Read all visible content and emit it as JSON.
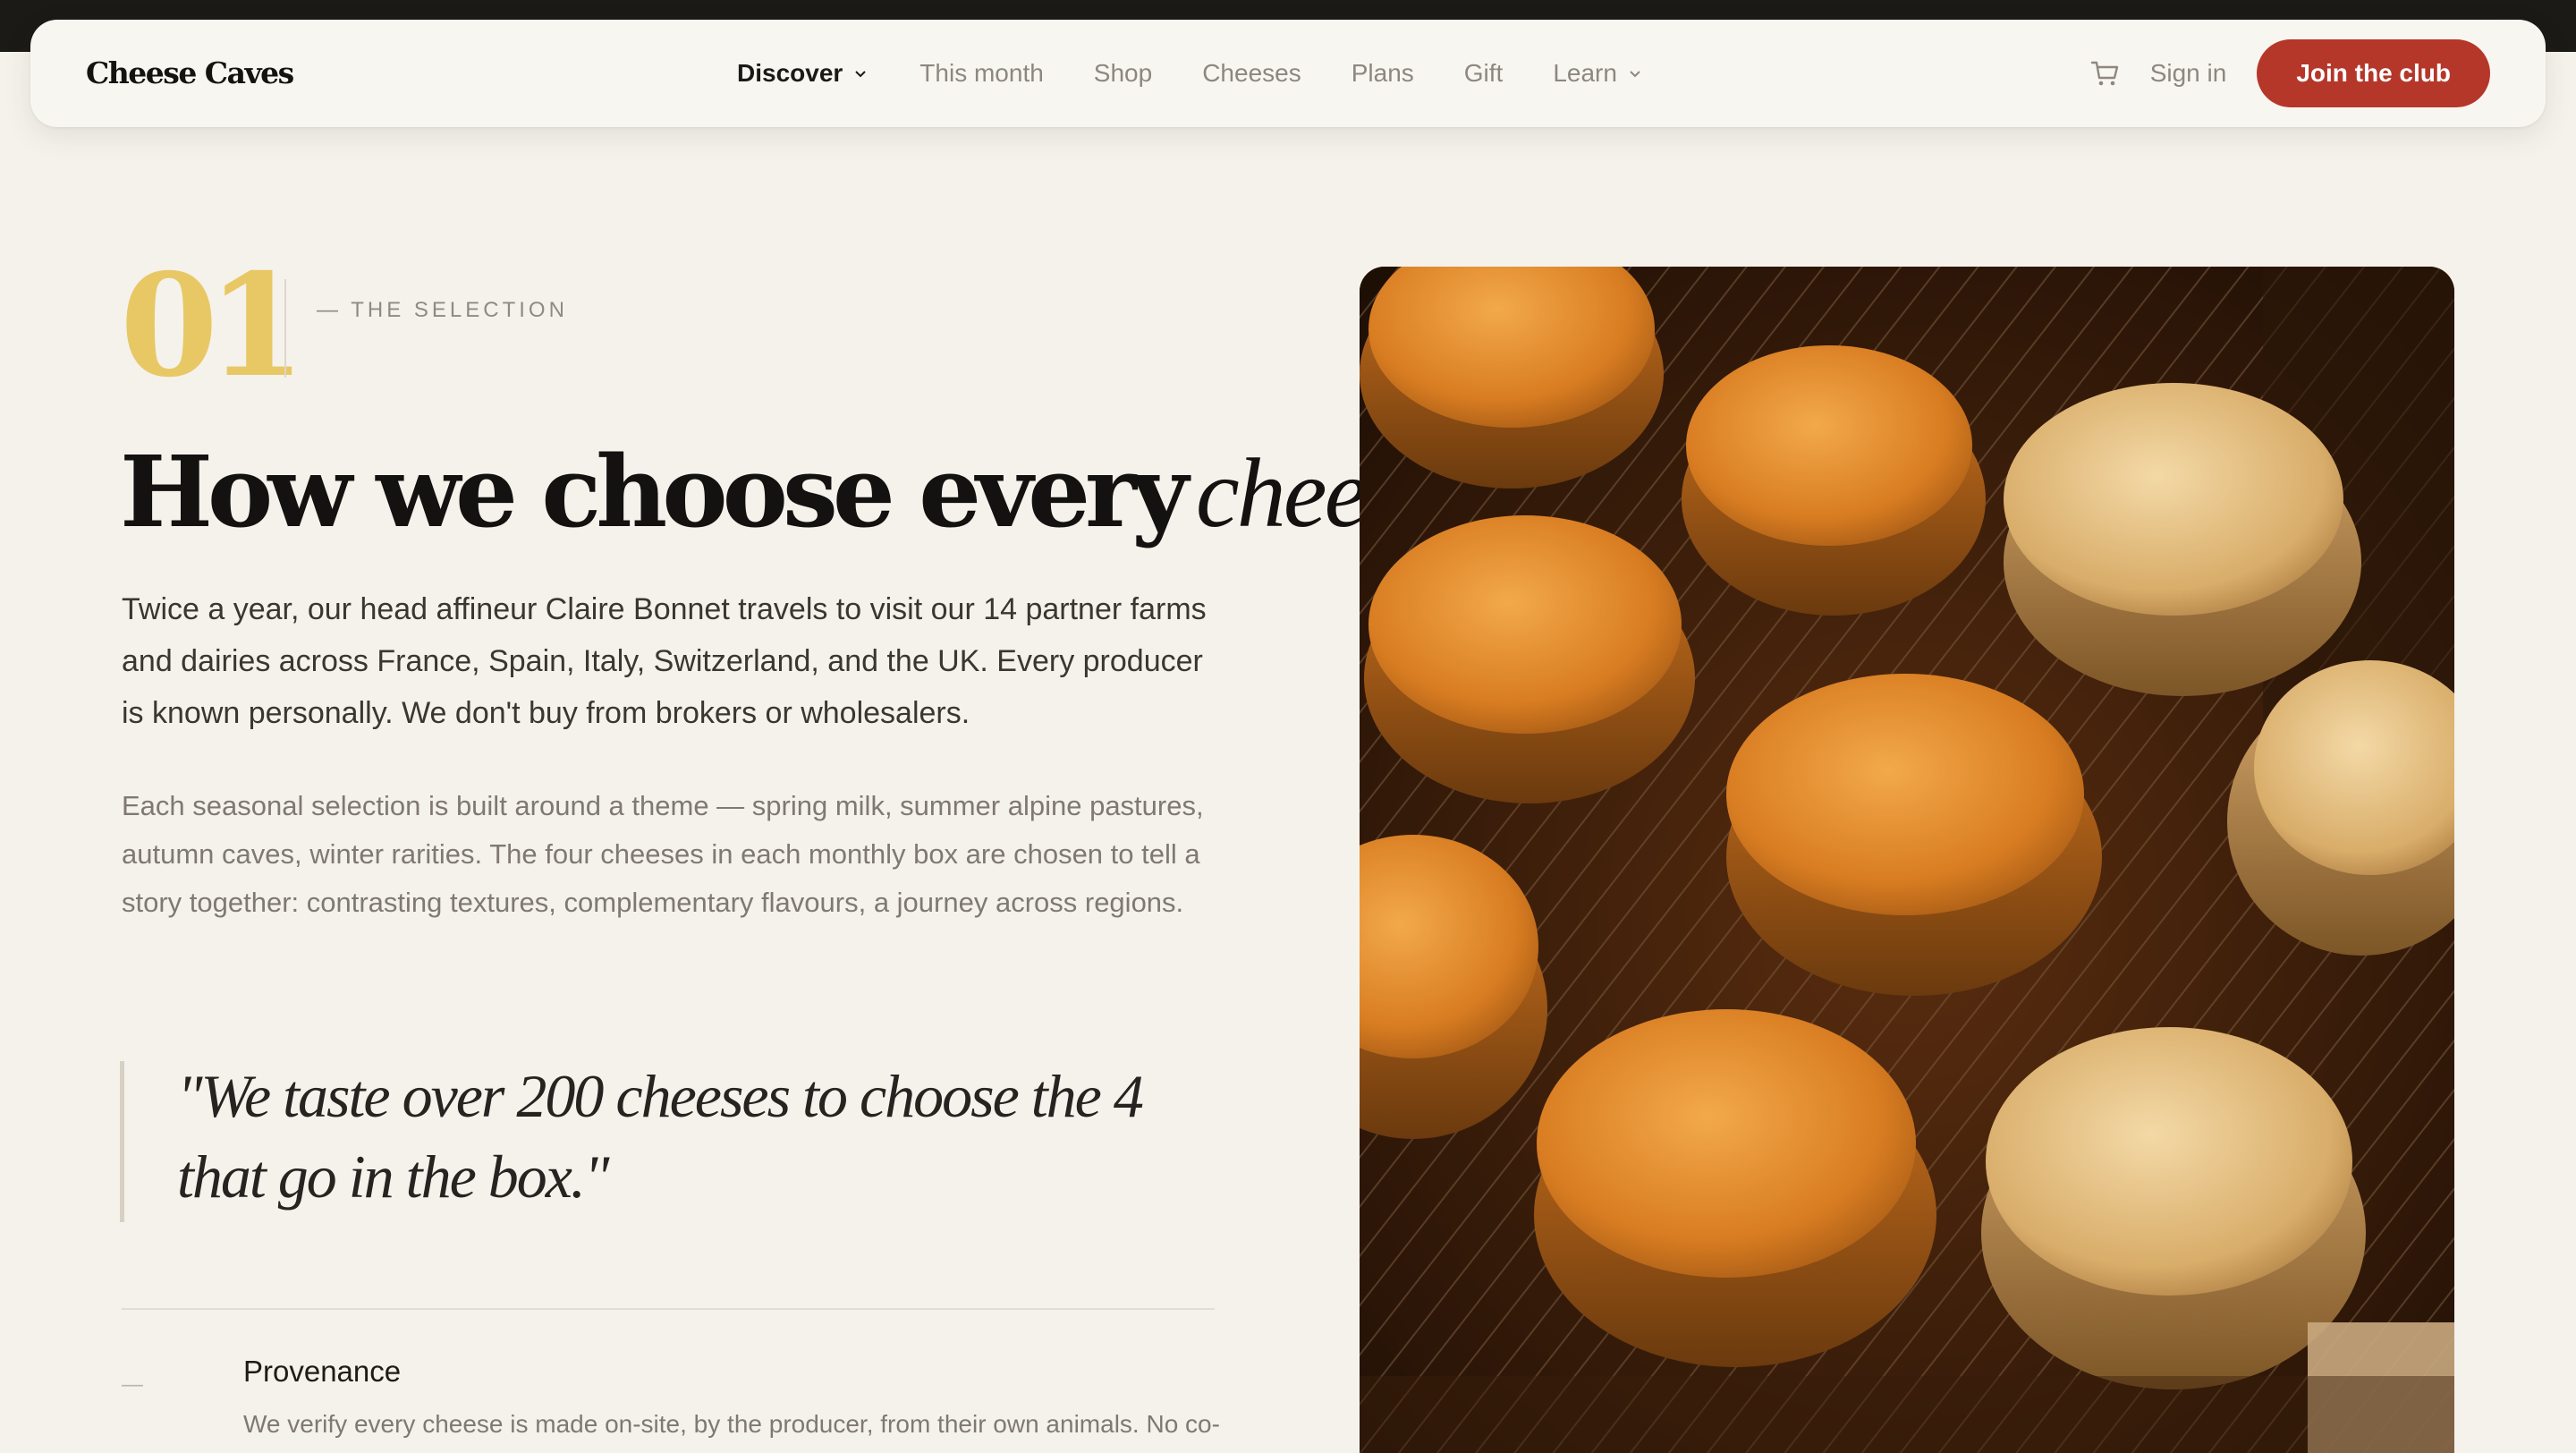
{
  "brand": {
    "name": "Cheese Caves"
  },
  "nav": {
    "items": [
      {
        "label": "Discover",
        "active": true,
        "has_dropdown": true
      },
      {
        "label": "This month",
        "active": false,
        "has_dropdown": false
      },
      {
        "label": "Shop",
        "active": false,
        "has_dropdown": false
      },
      {
        "label": "Cheeses",
        "active": false,
        "has_dropdown": false
      },
      {
        "label": "Plans",
        "active": false,
        "has_dropdown": false
      },
      {
        "label": "Gift",
        "active": false,
        "has_dropdown": false
      },
      {
        "label": "Learn",
        "active": false,
        "has_dropdown": true
      }
    ],
    "cart_icon": "cart-icon",
    "signin_label": "Sign in",
    "cta_label": "Join the club"
  },
  "section": {
    "number": "01",
    "eyebrow": "— THE SELECTION",
    "headline_bold": "How we choose every",
    "headline_italic": "cheese.",
    "lead": "Twice a year, our head affineur Claire Bonnet travels to visit our 14 partner farms and dairies across France, Spain, Italy, Switzerland, and the UK. Every producer is known personally. We don't buy from brokers or wholesalers.",
    "body": "Each seasonal selection is built around a theme — spring milk, summer alpine pastures, autumn caves, winter rarities. The four cheeses in each monthly box are chosen to tell a story together: contrasting textures, complementary flavours, a journey across regions.",
    "quote": "\"We taste over 200 cheeses to choose the 4 that go in the box.\"",
    "features": [
      {
        "dash": "—",
        "title": "Provenance",
        "description": "We verify every cheese is made on-site, by the producer, from their own animals. No co-"
      }
    ]
  },
  "image": {
    "alt": "Wheels of cheese ageing on racks in a cave"
  },
  "colors": {
    "background": "#f5f2ec",
    "accent": "#b5372a",
    "number_gold": "#e8c865",
    "text": "#1c1a17",
    "muted": "#8d8780"
  }
}
